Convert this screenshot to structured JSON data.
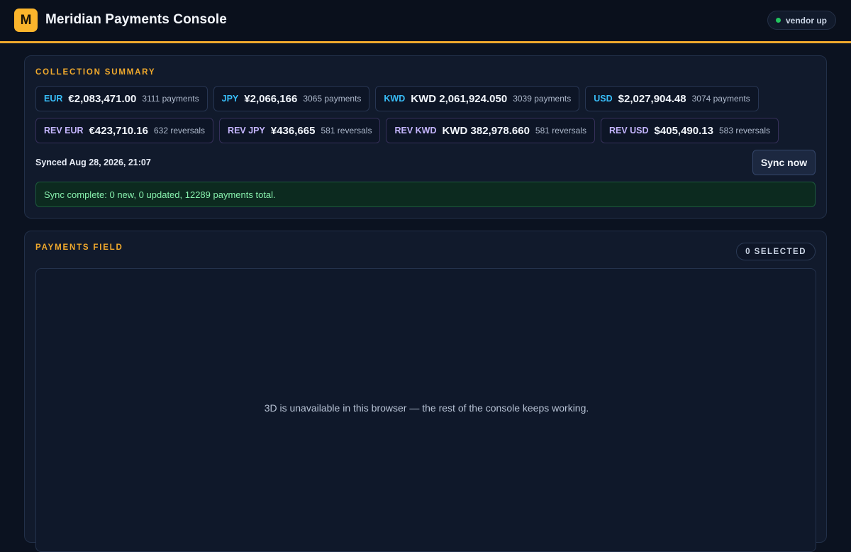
{
  "app": {
    "logo_letter": "M",
    "title": "Meridian Payments Console",
    "vendor_status": "vendor up",
    "vendor_status_color": "#22c55e",
    "accent_color": "#f0a92c"
  },
  "summary": {
    "title": "COLLECTION SUMMARY",
    "collections": [
      {
        "code": "EUR",
        "amount": "€2,083,471.00",
        "count": "3111 payments"
      },
      {
        "code": "JPY",
        "amount": "¥2,066,166",
        "count": "3065 payments"
      },
      {
        "code": "KWD",
        "amount": "KWD 2,061,924.050",
        "count": "3039 payments"
      },
      {
        "code": "USD",
        "amount": "$2,027,904.48",
        "count": "3074 payments"
      }
    ],
    "reversals": [
      {
        "code": "REV EUR",
        "amount": "€423,710.16",
        "count": "632 reversals"
      },
      {
        "code": "REV JPY",
        "amount": "¥436,665",
        "count": "581 reversals"
      },
      {
        "code": "REV KWD",
        "amount": "KWD 382,978.660",
        "count": "581 reversals"
      },
      {
        "code": "REV USD",
        "amount": "$405,490.13",
        "count": "583 reversals"
      }
    ],
    "synced_text": "Synced Aug 28, 2026, 21:07",
    "sync_button": "Sync now",
    "sync_message": "Sync complete: 0 new, 0 updated, 12289 payments total."
  },
  "field": {
    "title": "PAYMENTS FIELD",
    "selected": "0 SELECTED",
    "unavailable_message": "3D is unavailable in this browser — the rest of the console keeps working."
  }
}
